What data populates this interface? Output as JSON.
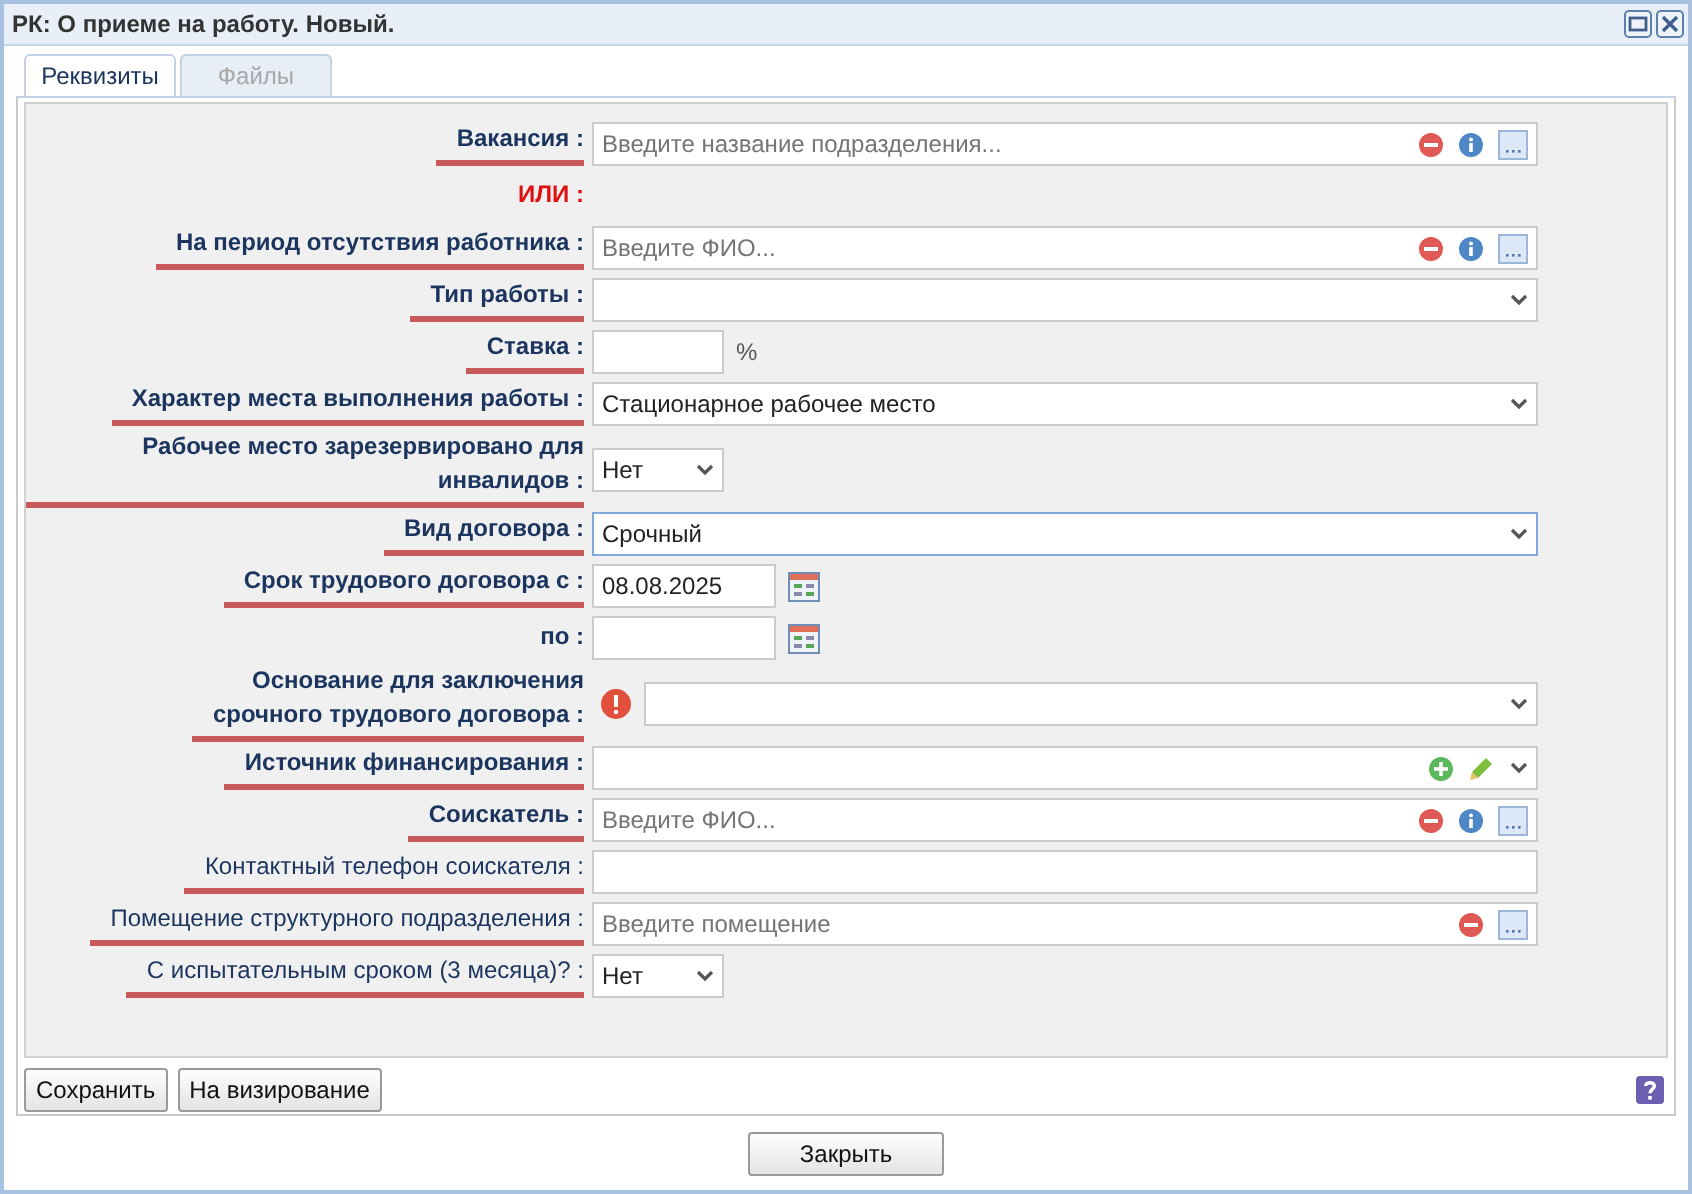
{
  "window": {
    "title": "РК: О приеме на работу. Новый."
  },
  "tabs": [
    {
      "label": "Реквизиты",
      "selected": true
    },
    {
      "label": "Файлы",
      "selected": false
    }
  ],
  "form": {
    "rows": [
      {
        "kind": "lookup",
        "label": "Вакансия :",
        "bold": true,
        "underlined": true,
        "placeholder": "Введите название подразделения...",
        "focused": false
      },
      {
        "kind": "note",
        "label": "ИЛИ :",
        "bold": true,
        "underlined": false
      },
      {
        "kind": "lookup",
        "label": "На период отсутствия работника :",
        "bold": true,
        "underlined": true,
        "placeholder": "Введите ФИО...",
        "focused": false
      },
      {
        "kind": "select",
        "label": "Тип работы :",
        "bold": true,
        "underlined": true,
        "focused": false
      },
      {
        "kind": "short-text",
        "label": "Ставка :",
        "bold": true,
        "underlined": true,
        "suffix": "%",
        "focused": false
      },
      {
        "kind": "select",
        "label": "Характер места выполнения работы :",
        "bold": true,
        "underlined": true,
        "value": "Стационарное рабочее место",
        "focused": false
      },
      {
        "kind": "small-select",
        "label": "Рабочее место зарезервировано для инвалидов :",
        "bold": true,
        "underlined": true,
        "value": "Нет",
        "focused": false
      },
      {
        "kind": "select",
        "label": "Вид договора :",
        "bold": true,
        "underlined": true,
        "value": "Срочный",
        "focused": true
      },
      {
        "kind": "date",
        "label": "Срок трудового договора с :",
        "bold": true,
        "underlined": true,
        "value": "08.08.2025",
        "focused": false
      },
      {
        "kind": "date",
        "label": "по :",
        "bold": true,
        "underlined": false,
        "focused": false
      },
      {
        "kind": "alert-select",
        "label": "Основание для заключения\nсрочного трудового договора :",
        "bold": true,
        "underlined": true,
        "focused": false
      },
      {
        "kind": "add-select",
        "label": "Источник финансирования :",
        "bold": true,
        "underlined": true,
        "focused": false
      },
      {
        "kind": "lookup",
        "label": "Соискатель :",
        "bold": true,
        "underlined": true,
        "placeholder": "Введите ФИО...",
        "focused": false
      },
      {
        "kind": "text",
        "label": "Контактный телефон соискателя :",
        "bold": false,
        "underlined": true,
        "focused": false
      },
      {
        "kind": "room",
        "label": "Помещение структурного подразделения :",
        "bold": false,
        "underlined": true,
        "placeholder": "Введите помещение",
        "focused": false
      },
      {
        "kind": "small-select",
        "label": "С испытательным сроком (3 месяца)? :",
        "bold": false,
        "underlined": true,
        "value": "Нет",
        "focused": false
      }
    ]
  },
  "footer_buttons": [
    "Сохранить",
    "На визирование"
  ],
  "close_button": "Закрыть"
}
